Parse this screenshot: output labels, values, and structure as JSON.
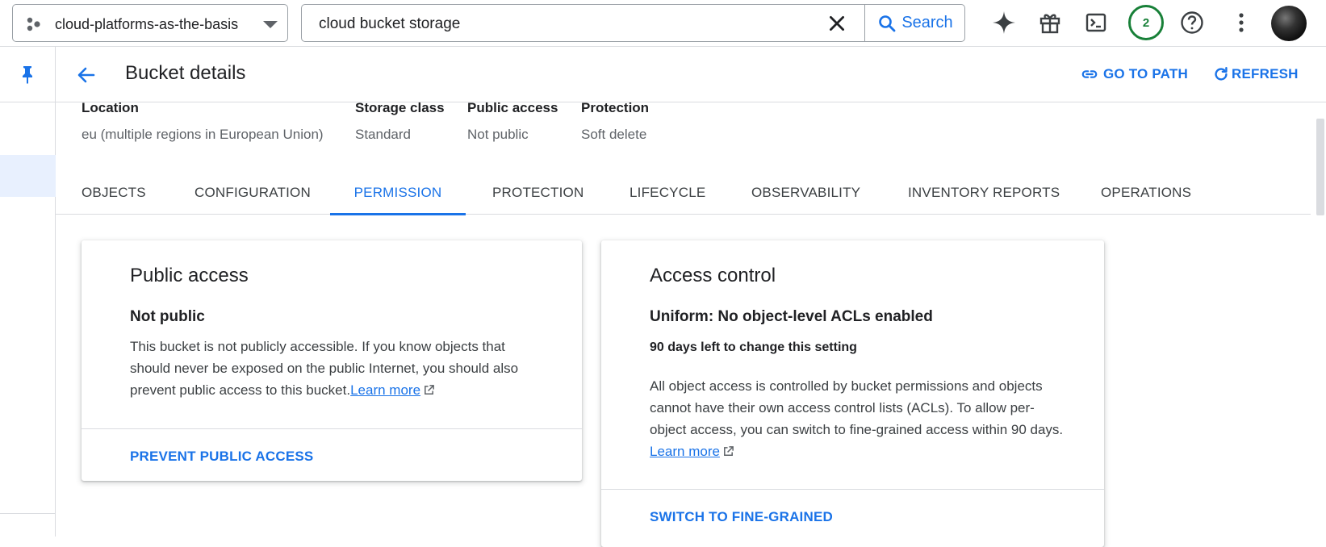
{
  "topbar": {
    "project_label": "cloud-platforms-as-the-basis",
    "search_value": "cloud bucket storage",
    "search_button": "Search",
    "notifications_count": "2"
  },
  "header": {
    "title": "Bucket details",
    "go_to_path": "GO TO PATH",
    "refresh": "REFRESH"
  },
  "summary": [
    {
      "label": "Location",
      "value": "eu (multiple regions in European Union)"
    },
    {
      "label": "Storage class",
      "value": "Standard"
    },
    {
      "label": "Public access",
      "value": "Not public"
    },
    {
      "label": "Protection",
      "value": "Soft delete"
    }
  ],
  "tabs": [
    "OBJECTS",
    "CONFIGURATION",
    "PERMISSION",
    "PROTECTION",
    "LIFECYCLE",
    "OBSERVABILITY",
    "INVENTORY REPORTS",
    "OPERATIONS"
  ],
  "active_tab": "PERMISSION",
  "public_access_card": {
    "title": "Public access",
    "status": "Not public",
    "body_line1": "This bucket is not publicly accessible. If you know objects that",
    "body_line2": "should never be exposed on the public Internet, you should also",
    "body_line3": "prevent public access to this bucket.",
    "learn_more": "Learn more",
    "action": "PREVENT PUBLIC ACCESS"
  },
  "access_control_card": {
    "title": "Access control",
    "status": "Uniform: No object-level ACLs enabled",
    "days_left": "90 days left to change this setting",
    "body_line1": "All object access is controlled by bucket permissions and objects",
    "body_line2": "cannot have their own access control lists (ACLs). To allow per-",
    "body_line3": "object access, you can switch to fine-grained access within 90 days.",
    "learn_more": "Learn more",
    "action": "SWITCH TO FINE-GRAINED"
  },
  "colors": {
    "accent": "#1a73e8",
    "badge_green": "#188038",
    "active_rail": "#e8f0fe"
  }
}
